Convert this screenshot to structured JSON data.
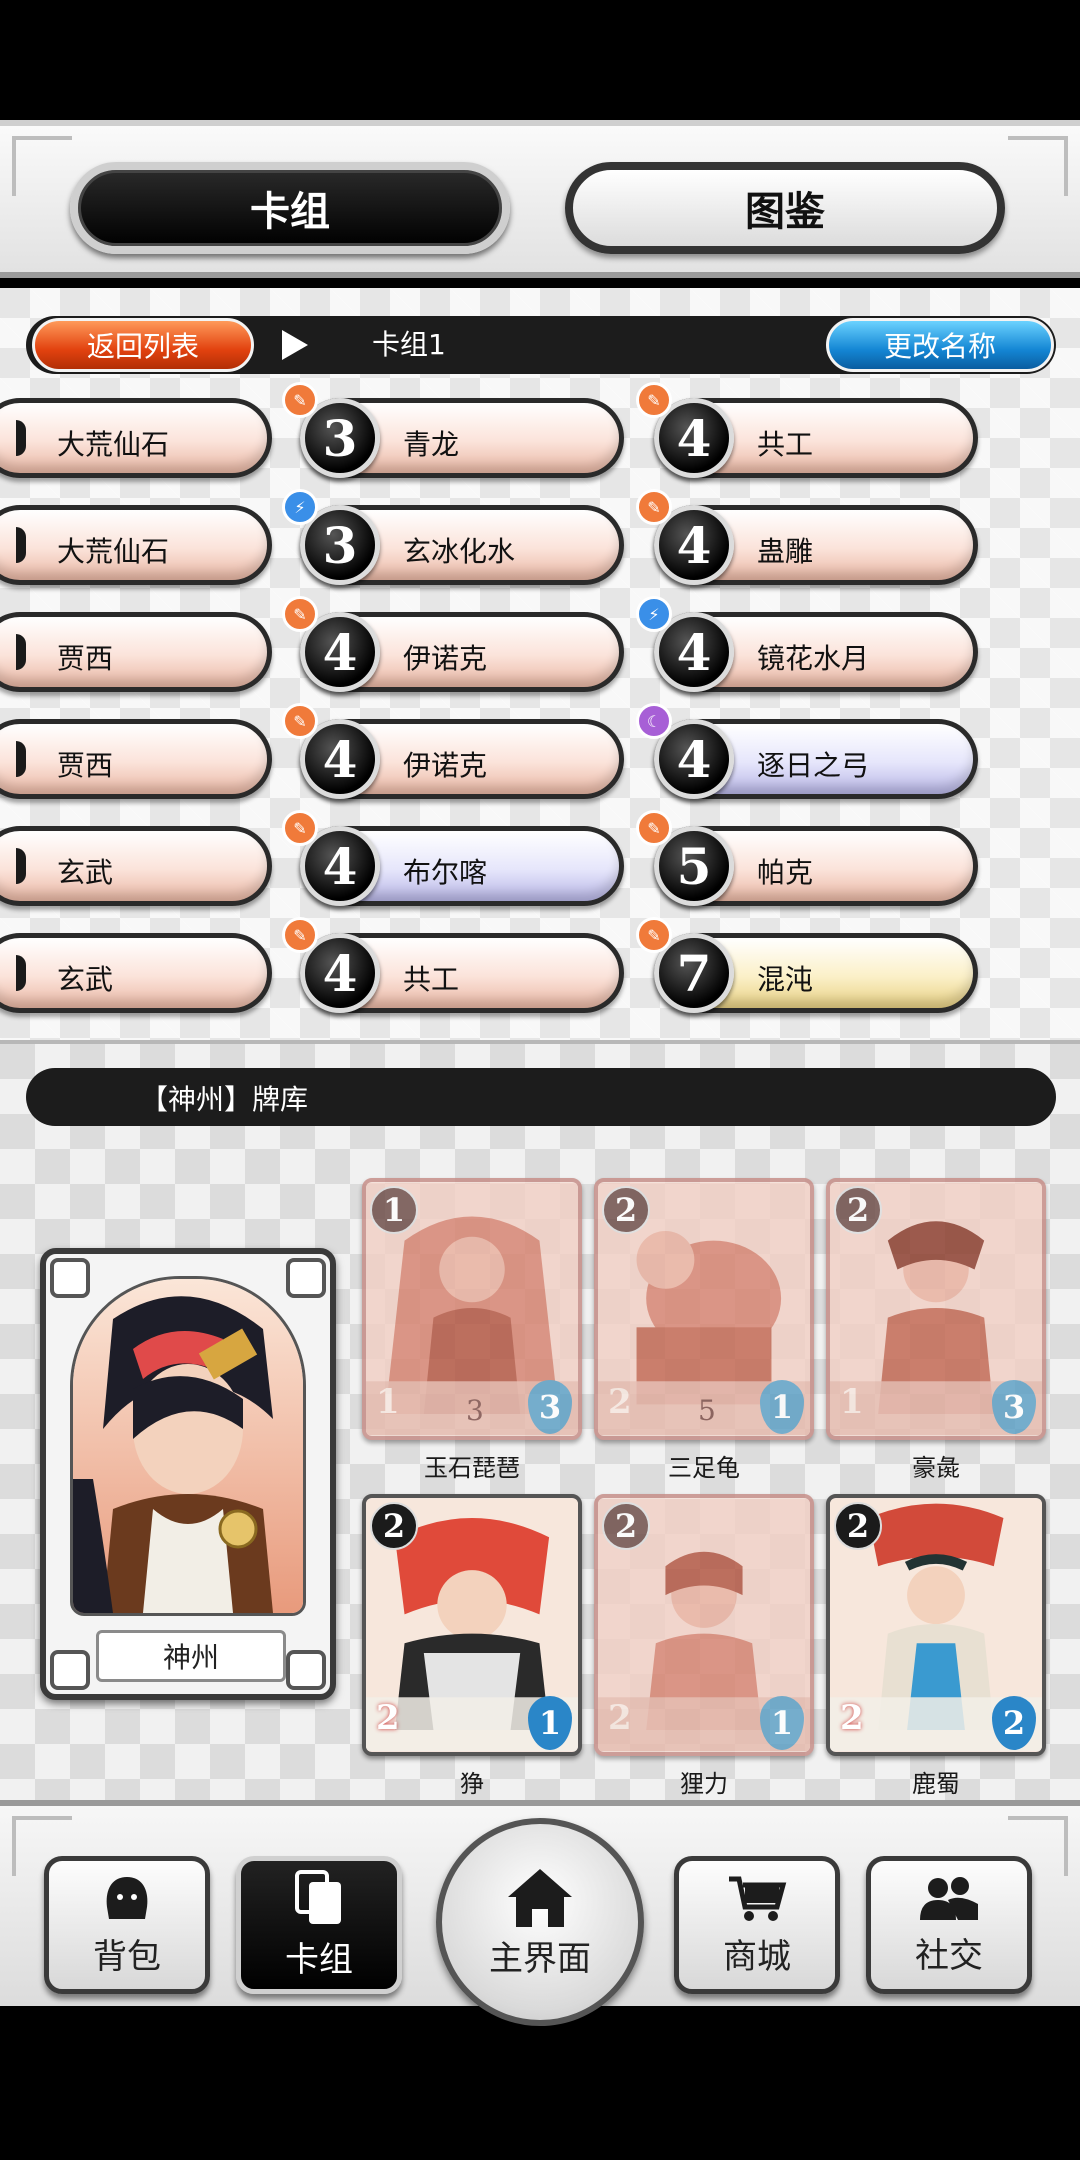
{
  "tabs": {
    "deck": "卡组",
    "codex": "图鉴"
  },
  "deck_bar": {
    "back_label": "返回列表",
    "deck_name": "卡组1",
    "rename_label": "更改名称"
  },
  "deck_columns": [
    [
      {
        "name": "大荒仙石"
      },
      {
        "name": "大荒仙石"
      },
      {
        "name": "贾西"
      },
      {
        "name": "贾西"
      },
      {
        "name": "玄武"
      },
      {
        "name": "玄武"
      }
    ],
    [
      {
        "cost": "3",
        "name": "青龙",
        "element": "fire",
        "tint": "red"
      },
      {
        "cost": "3",
        "name": "玄冰化水",
        "element": "light",
        "tint": "red"
      },
      {
        "cost": "4",
        "name": "伊诺克",
        "element": "fire",
        "tint": "red"
      },
      {
        "cost": "4",
        "name": "伊诺克",
        "element": "fire",
        "tint": "red"
      },
      {
        "cost": "4",
        "name": "布尔喀",
        "element": "fire",
        "tint": "blue"
      },
      {
        "cost": "4",
        "name": "共工",
        "element": "fire",
        "tint": "red"
      }
    ],
    [
      {
        "cost": "4",
        "name": "共工",
        "element": "fire",
        "tint": "red"
      },
      {
        "cost": "4",
        "name": "蛊雕",
        "element": "fire",
        "tint": "red"
      },
      {
        "cost": "4",
        "name": "镜花水月",
        "element": "light",
        "tint": "red"
      },
      {
        "cost": "4",
        "name": "逐日之弓",
        "element": "moon",
        "tint": "blue"
      },
      {
        "cost": "5",
        "name": "帕克",
        "element": "fire",
        "tint": "red"
      },
      {
        "cost": "7",
        "name": "混沌",
        "element": "fire",
        "tint": "gold"
      }
    ]
  ],
  "library": {
    "title": "【神州】牌库",
    "hero": {
      "name": "神州"
    },
    "cards": [
      {
        "name": "玉石琵琶",
        "cost": "1",
        "atk": "1",
        "hp": "3",
        "mid": "3",
        "dim": true
      },
      {
        "name": "三足龟",
        "cost": "2",
        "atk": "2",
        "hp": "1",
        "mid": "5",
        "dim": true
      },
      {
        "name": "豪彘",
        "cost": "2",
        "atk": "1",
        "hp": "3",
        "mid": "",
        "dim": true
      },
      {
        "name": "狰",
        "cost": "2",
        "atk": "2",
        "hp": "1",
        "mid": "",
        "dim": false
      },
      {
        "name": "狸力",
        "cost": "2",
        "atk": "2",
        "hp": "1",
        "mid": "",
        "dim": true
      },
      {
        "name": "鹿蜀",
        "cost": "2",
        "atk": "2",
        "hp": "2",
        "mid": "",
        "dim": false
      }
    ]
  },
  "nav": {
    "bag": "背包",
    "deck": "卡组",
    "home": "主界面",
    "shop": "商城",
    "social": "社交"
  },
  "colors": {
    "fire": "#f07a3a",
    "light": "#3a8fe8",
    "moon": "#a75fd6",
    "back_btn": "#e2420f",
    "rename_btn": "#1486d4"
  }
}
